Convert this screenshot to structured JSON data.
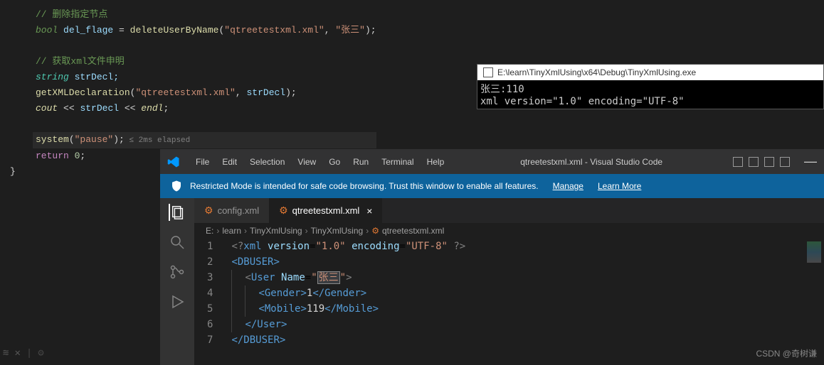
{
  "bgcode": {
    "c1": "// 删除指定节点",
    "l2_kw": "bool ",
    "l2_var": "del_flage",
    "l2_eq": " = ",
    "l2_fn": "deleteUserByName",
    "l2_args_open": "(",
    "l2_str1": "\"qtreetestxml.xml\"",
    "l2_comma": ", ",
    "l2_str2": "\"张三\"",
    "l2_close": ");",
    "c3": "// 获取xml文件申明",
    "l4_type": "string ",
    "l4_var": "strDecl;",
    "l5_fn": "getXMLDeclaration",
    "l5_open": "(",
    "l5_str": "\"qtreetestxml.xml\"",
    "l5_comma": ", ",
    "l5_arg2": "strDecl",
    "l5_close": ");",
    "l6_cout": "cout",
    "l6_op": " << ",
    "l6_var": "strDecl",
    "l6_op2": " << ",
    "l6_endl": "endl",
    "l6_semi": ";",
    "l7_fn": "system",
    "l7_open": "(",
    "l7_str": "\"pause\"",
    "l7_close": ");",
    "l7_elapsed": " ≤ 2ms elapsed",
    "l8_ret": "return ",
    "l8_num": "0",
    "l8_semi": ";",
    "brace": "}"
  },
  "console": {
    "title": "E:\\learn\\TinyXmlUsing\\x64\\Debug\\TinyXmlUsing.exe",
    "line1": "张三:110",
    "line2": "xml version=\"1.0\" encoding=\"UTF-8\""
  },
  "vscode": {
    "menu": [
      "File",
      "Edit",
      "Selection",
      "View",
      "Go",
      "Run",
      "Terminal",
      "Help"
    ],
    "title": "qtreetestxml.xml - Visual Studio Code",
    "banner_text": "Restricted Mode is intended for safe code browsing. Trust this window to enable all features.",
    "banner_manage": "Manage",
    "banner_learn": "Learn More",
    "tabs": [
      {
        "name": "config.xml",
        "active": false
      },
      {
        "name": "qtreetestxml.xml",
        "active": true
      }
    ],
    "breadcrumb": [
      "E:",
      "learn",
      "TinyXmlUsing",
      "TinyXmlUsing",
      "qtreetestxml.xml"
    ],
    "lines": {
      "ln1": "1",
      "ln2": "2",
      "ln3": "3",
      "ln4": "4",
      "ln5": "5",
      "ln6": "6",
      "ln7": "7"
    },
    "xml": {
      "pi_open": "<?",
      "pi_xml": "xml ",
      "pi_ver_attr": "version",
      "pi_ver_val": "\"1.0\"",
      "pi_enc_attr": "encoding",
      "pi_enc_val": "\"UTF-8\"",
      "pi_close": " ?>",
      "dbuser_open": "<DBUSER>",
      "user_open_tag": "User",
      "user_attr": "Name",
      "user_attr_val_open": "\"",
      "user_attr_val": "张三",
      "user_attr_val_close": "\"",
      "gender_open": "<Gender>",
      "gender_val": "1",
      "gender_close": "</Gender>",
      "mobile_open": "<Mobile>",
      "mobile_val": "119",
      "mobile_close": "</Mobile>",
      "user_close": "</User>",
      "dbuser_close": "</DBUSER>"
    }
  },
  "watermark": "CSDN @奇树谦"
}
